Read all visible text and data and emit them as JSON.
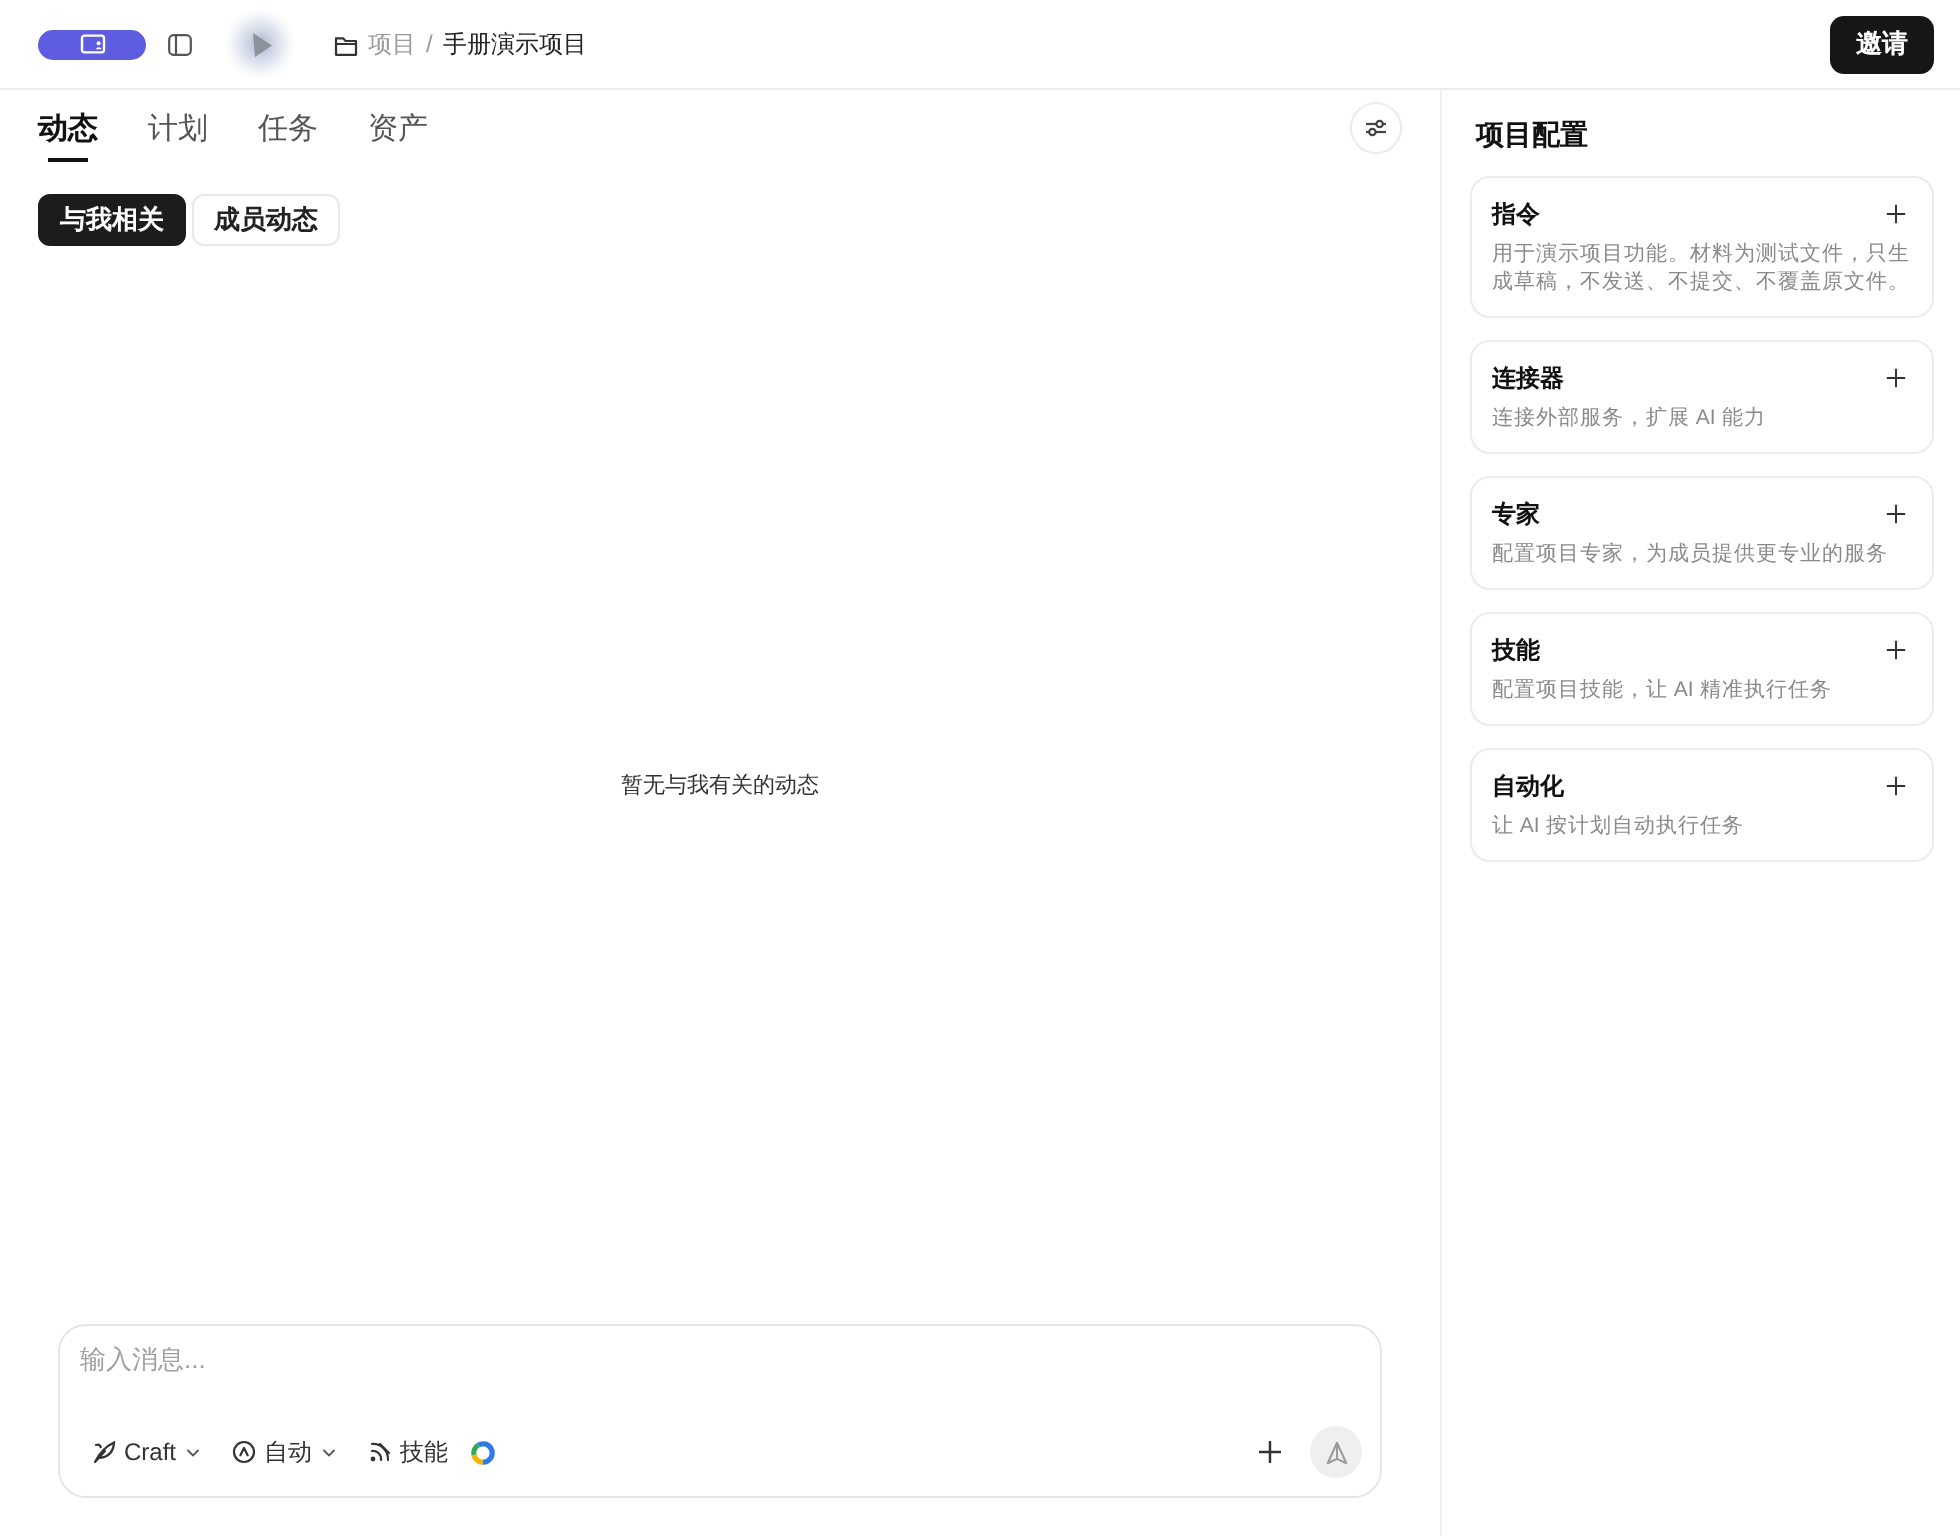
{
  "top_bar": {
    "breadcrumb": [
      {
        "label": "项目",
        "current": false
      },
      {
        "label": "手册演示项目",
        "current": true
      }
    ],
    "separator": "/",
    "invite_button": "邀请"
  },
  "tabs": [
    {
      "label": "动态",
      "selected": true
    },
    {
      "label": "计划",
      "selected": false
    },
    {
      "label": "任务",
      "selected": false
    },
    {
      "label": "资产",
      "selected": false
    }
  ],
  "filters": [
    {
      "label": "与我相关",
      "selected": true
    },
    {
      "label": "成员动态",
      "selected": false
    }
  ],
  "empty_message": "暂无与我有关的动态",
  "composer": {
    "placeholder": "输入消息...",
    "tools": [
      {
        "kind": "model",
        "label": "Craft"
      },
      {
        "kind": "mode",
        "label": "自动"
      },
      {
        "kind": "skills",
        "label": "技能"
      }
    ]
  },
  "config_panel": {
    "title": "项目配置",
    "cards": [
      {
        "title": "指令",
        "description": "用于演示项目功能。材料为测试文件，只生成草稿，不发送、不提交、不覆盖原文件。"
      },
      {
        "title": "连接器",
        "description": "连接外部服务，扩展 AI 能力"
      },
      {
        "title": "专家",
        "description": "配置项目专家，为成员提供更专业的服务"
      },
      {
        "title": "技能",
        "description": "配置项目技能，让 AI 精准执行任务"
      },
      {
        "title": "自动化",
        "description": "让 AI 按计划自动执行任务"
      }
    ]
  }
}
